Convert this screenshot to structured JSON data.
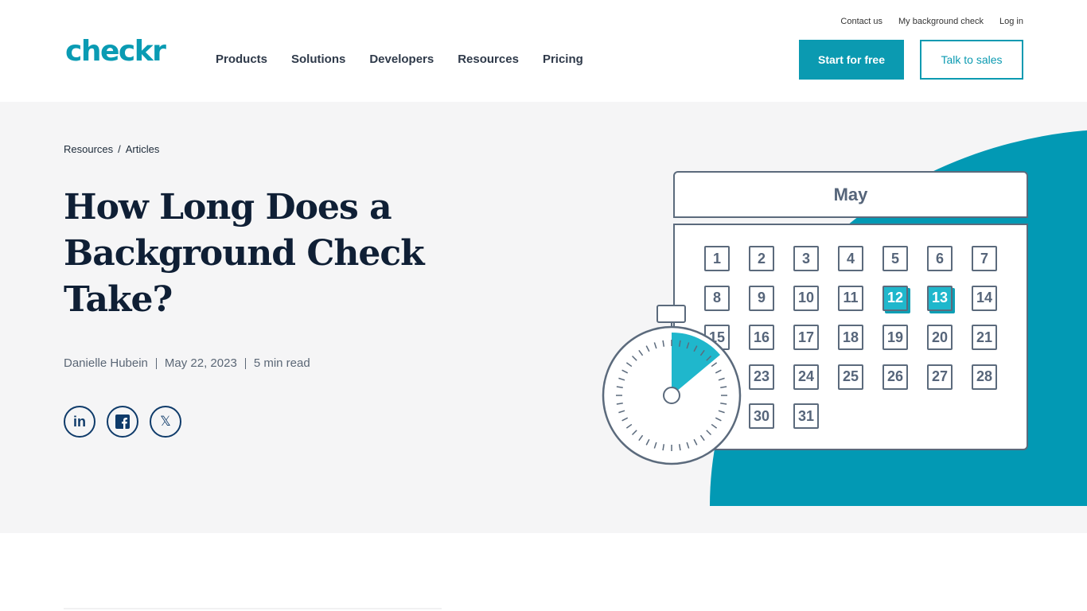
{
  "header": {
    "logo": "checkr",
    "utility_links": [
      "Contact us",
      "My background check",
      "Log in"
    ],
    "nav": [
      "Products",
      "Solutions",
      "Developers",
      "Resources",
      "Pricing"
    ],
    "start_label": "Start for free",
    "sales_label": "Talk to sales"
  },
  "hero": {
    "breadcrumb": [
      "Resources",
      "Articles"
    ],
    "title": "How Long Does a Background Check Take?",
    "author": "Danielle Hubein",
    "date": "May 22, 2023",
    "read_time": "5 min read",
    "social": [
      "linkedin-icon",
      "facebook-icon",
      "x-icon"
    ]
  },
  "illustration": {
    "month": "May",
    "days": [
      1,
      2,
      3,
      4,
      5,
      6,
      7,
      8,
      9,
      10,
      11,
      12,
      13,
      14,
      15,
      16,
      17,
      18,
      19,
      20,
      21,
      23,
      24,
      25,
      26,
      27,
      28,
      30,
      31
    ],
    "highlighted": [
      12,
      13
    ],
    "accent": "#0299b4",
    "highlight_color": "#1fb7cc"
  }
}
